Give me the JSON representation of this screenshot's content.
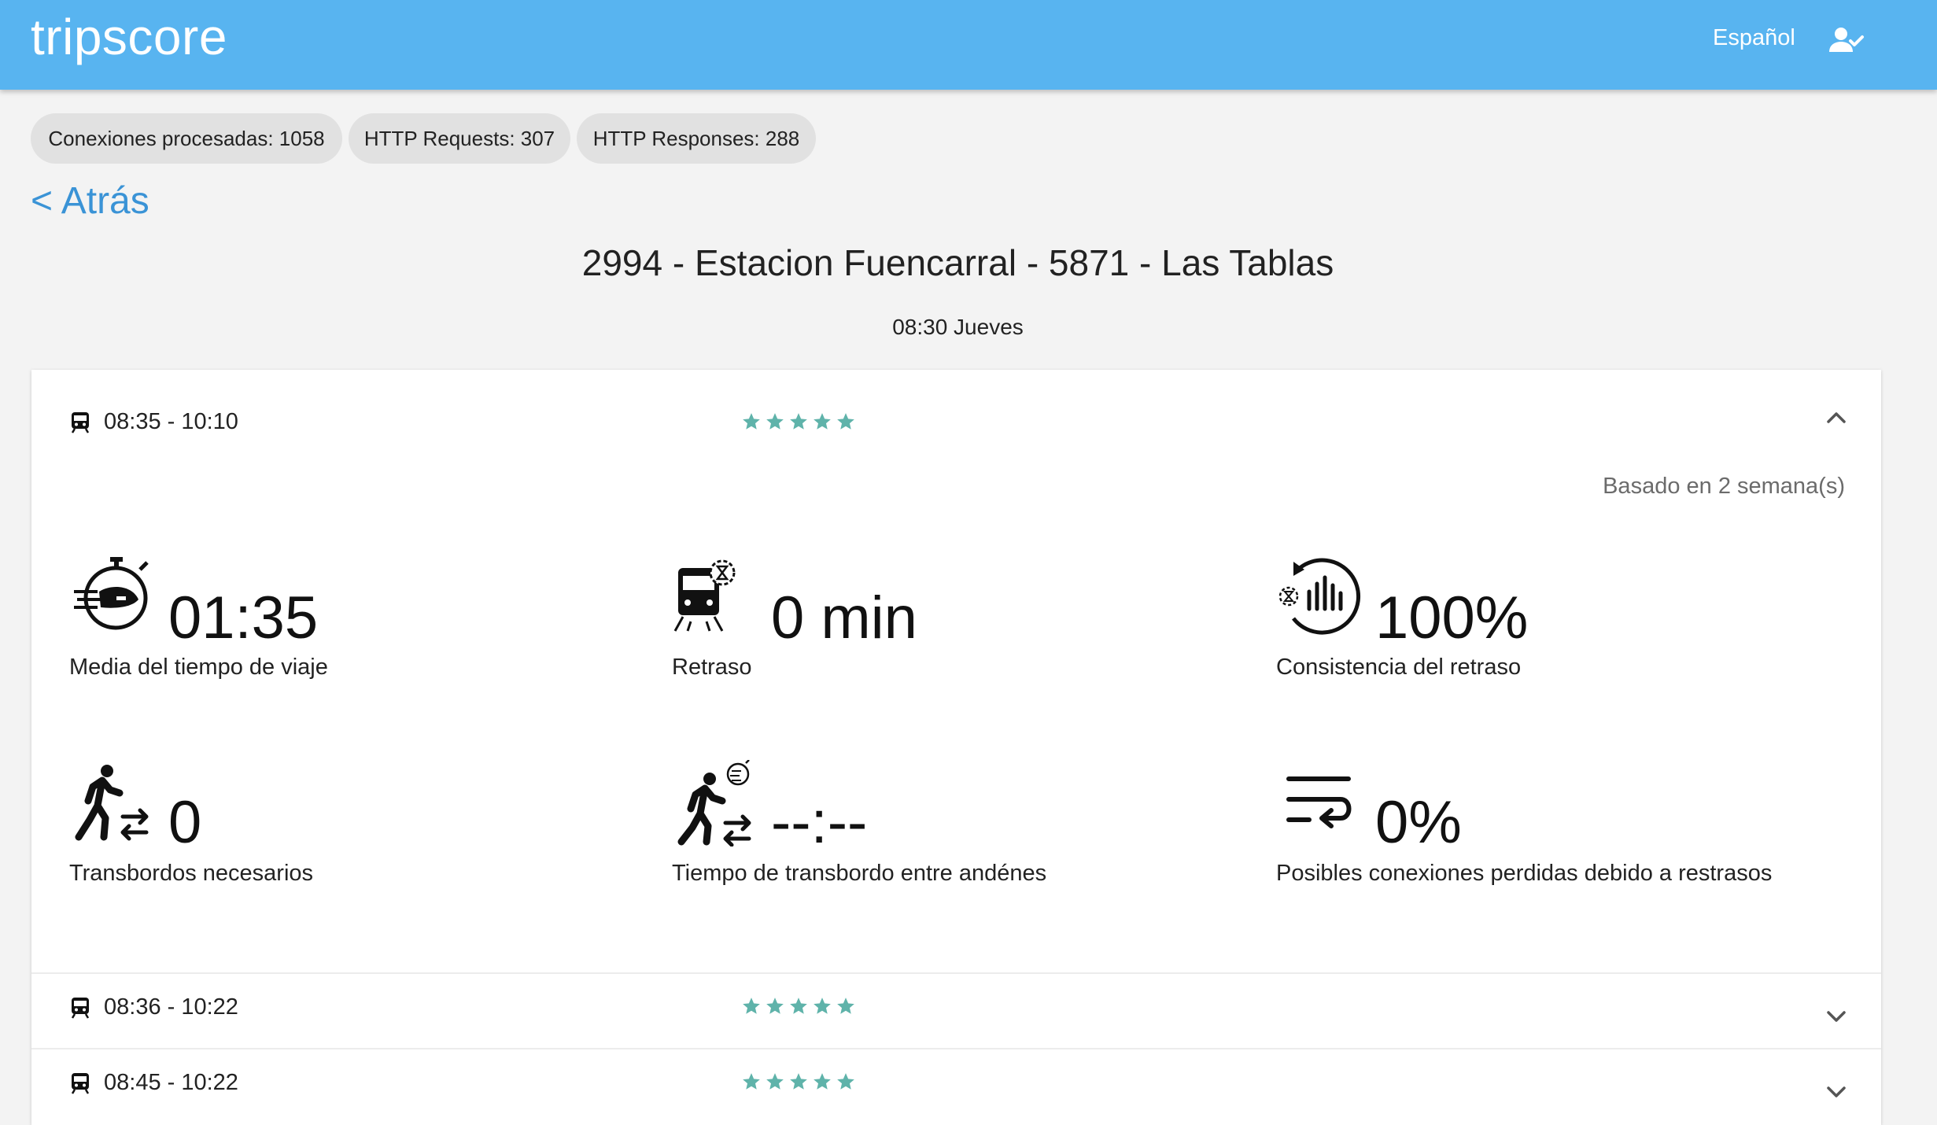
{
  "header": {
    "logo": "tripscore",
    "language": "Español",
    "user_icon": "user-check-icon",
    "bg_color": "#58b4f0"
  },
  "stats": [
    {
      "label": "Conexiones procesadas: 1058"
    },
    {
      "label": "HTTP Requests: 307"
    },
    {
      "label": "HTTP Responses: 288"
    }
  ],
  "nav": {
    "back_label": "< Atrás"
  },
  "route": {
    "title": "2994 - Estacion Fuencarral - 5871 - Las Tablas",
    "subtitle": "08:30 Jueves"
  },
  "trips": [
    {
      "time": "08:35 - 10:10",
      "rating": 5,
      "expanded": true,
      "based_on": "Basado en 2 semana(s)",
      "metrics": [
        {
          "icon": "stopwatch-train-icon",
          "value": "01:35",
          "label": "Media del tiempo de viaje"
        },
        {
          "icon": "delayed-train-icon",
          "value": "0 min",
          "label": "Retraso"
        },
        {
          "icon": "consistency-icon",
          "value": "100%",
          "label": "Consistencia del retraso"
        },
        {
          "icon": "walking-transfer-icon",
          "value": "0",
          "label": "Transbordos necesarios"
        },
        {
          "icon": "walking-transfer-timer-icon",
          "value": "--:--",
          "label": "Tiempo de transbordo entre andénes"
        },
        {
          "icon": "missed-connection-icon",
          "value": "0%",
          "label": "Posibles conexiones perdidas debido a restrasos"
        }
      ]
    },
    {
      "time": "08:36 - 10:22",
      "rating": 5,
      "expanded": false
    },
    {
      "time": "08:45 - 10:22",
      "rating": 5,
      "expanded": false
    }
  ],
  "colors": {
    "star": "#5fb3aa",
    "link": "#3a93d6"
  }
}
